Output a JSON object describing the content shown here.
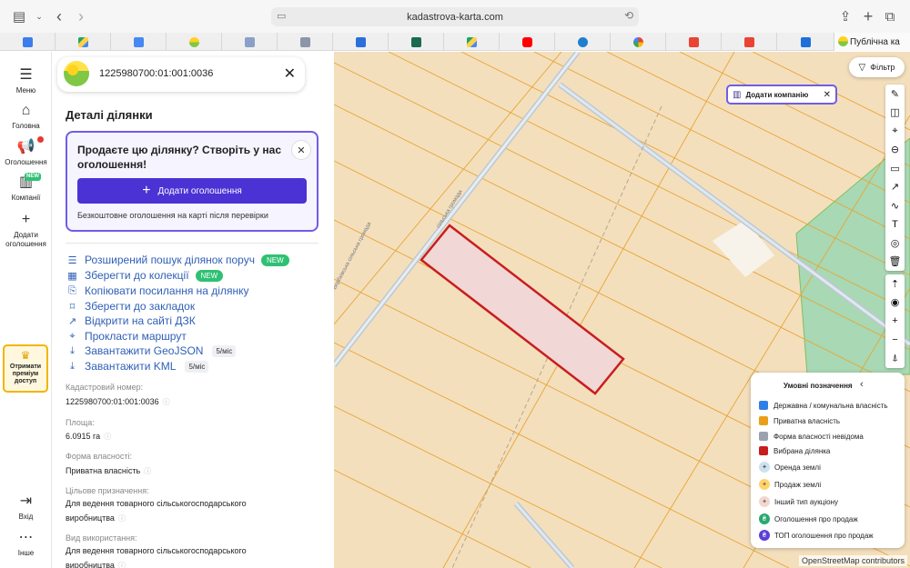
{
  "browser": {
    "url": "kadastrova-karta.com",
    "last_tab_label": "Публічна ка"
  },
  "rail": {
    "menu": "Меню",
    "home": "Головна",
    "ads": "Оголошення",
    "companies": "Компанії",
    "companies_badge": "NEW",
    "add_ad_line1": "Додати",
    "add_ad_line2": "оголошення",
    "premium_line1": "Отримати",
    "premium_line2": "преміум",
    "premium_line3": "доступ",
    "login": "Вхід",
    "more": "Інше"
  },
  "panel": {
    "cadastral_title": "1225980700:01:001:0036",
    "heading": "Деталі ділянки",
    "promo": {
      "title": "Продаєте цю ділянку? Створіть у нас оголошення!",
      "button": "Додати оголошення",
      "note": "Безкоштовне оголошення на карті після перевірки"
    },
    "actions": [
      {
        "label": "Розширений пошук ділянок поруч",
        "badge": "NEW",
        "icon": "sliders-icon"
      },
      {
        "label": "Зберегти до колекції",
        "badge": "NEW",
        "icon": "collection-icon"
      },
      {
        "label": "Копіювати посилання на ділянку",
        "badge": "",
        "icon": "copy-icon"
      },
      {
        "label": "Зберегти до закладок",
        "badge": "",
        "icon": "bookmark-icon"
      },
      {
        "label": "Відкрити на сайті ДЗК",
        "badge": "",
        "icon": "external-link-icon"
      },
      {
        "label": "Прокласти маршрут",
        "badge": "",
        "icon": "pin-icon"
      },
      {
        "label": "Завантажити GeoJSON",
        "limit": "5/міс",
        "icon": "download-icon"
      },
      {
        "label": "Завантажити KML",
        "limit": "5/міс",
        "icon": "download-icon"
      }
    ],
    "fields": {
      "cadastral_label": "Кадастровий номер:",
      "cadastral_value": "1225980700:01:001:0036",
      "area_label": "Площа:",
      "area_value": "6.0915 га",
      "ownership_label": "Форма власності:",
      "ownership_value": "Приватна власність",
      "purpose_label": "Цільове призначення:",
      "purpose_value": "Для ведення товарного сільськогосподарського виробництва",
      "usage_label": "Вид використання:",
      "usage_value": "Для ведення товарного сільськогосподарського виробництва"
    }
  },
  "map": {
    "filter": "Фільтр",
    "add_company": "Додати компанію",
    "road_label_1": "Вербківська сільська громада",
    "road_label_2": "сільська громада",
    "attribution": "OpenStreetMap contributors",
    "legend": {
      "title": "Умовні позначення",
      "items": [
        {
          "label": "Державна / комунальна власність",
          "color": "#2f7fe8"
        },
        {
          "label": "Приватна власність",
          "color": "#e8a019"
        },
        {
          "label": "Форма власності невідома",
          "color": "#9aa2ad"
        },
        {
          "label": "Вибрана ділянка",
          "color": "#c81e1e"
        },
        {
          "label": "Оренда землі",
          "color": "#cfe0ee"
        },
        {
          "label": "Продаж землі",
          "color": "#ffd56b"
        },
        {
          "label": "Інший тип аукціону",
          "color": "#f2d7d0"
        },
        {
          "label": "Оголошення про продаж",
          "color": "#2aa870"
        },
        {
          "label": "ТОП оголошення про продаж",
          "color": "#5b3fd6"
        }
      ]
    }
  }
}
